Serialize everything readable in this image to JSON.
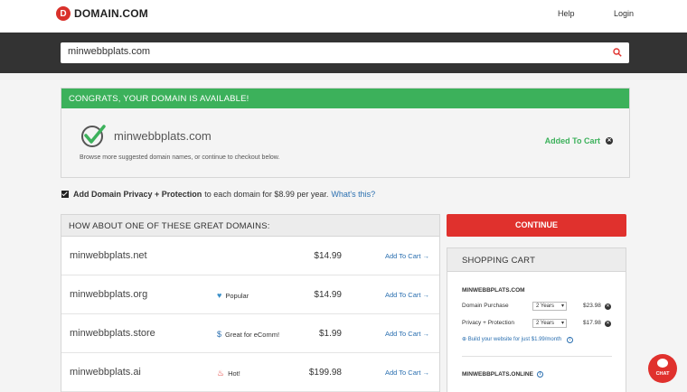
{
  "header": {
    "logo_text": "DOMAIN.COM",
    "logo_letter": "D",
    "help": "Help",
    "login": "Login"
  },
  "search": {
    "value": "minwebbplats.com"
  },
  "available": {
    "heading": "CONGRATS, YOUR DOMAIN IS AVAILABLE!",
    "domain": "minwebbplats.com",
    "subtext": "Browse more suggested domain names, or continue to checkout below.",
    "status": "Added To Cart"
  },
  "privacy": {
    "bold": "Add Domain Privacy + Protection",
    "text": "to each domain for $8.99 per year.",
    "link": "What's this?"
  },
  "suggestions": {
    "heading": "HOW ABOUT ONE OF THESE GREAT DOMAINS:",
    "add_label": "Add To Cart →",
    "rows": [
      {
        "name": "minwebbplats.net",
        "badge": "",
        "badge_icon": "",
        "price": "$14.99"
      },
      {
        "name": "minwebbplats.org",
        "badge": "Popular",
        "badge_icon": "heart-icon",
        "price": "$14.99"
      },
      {
        "name": "minwebbplats.store",
        "badge": "Great for eComm!",
        "badge_icon": "dollar-icon",
        "price": "$1.99"
      },
      {
        "name": "minwebbplats.ai",
        "badge": "Hot!",
        "badge_icon": "fire-icon",
        "price": "$199.98"
      }
    ]
  },
  "continue_label": "CONTINUE",
  "cart": {
    "heading": "SHOPPING CART",
    "domain": "MINWEBBPLATS.COM",
    "lines": [
      {
        "label": "Domain Purchase",
        "term": "2 Years",
        "price": "$23.98"
      },
      {
        "label": "Privacy + Protection",
        "term": "2 Years",
        "price": "$17.98"
      }
    ],
    "build": "Build your website for just $1.99/month",
    "domain2": "MINWEBBPLATS.ONLINE"
  },
  "chat_label": "CHAT",
  "colors": {
    "brand_red": "#e0312d",
    "success_green": "#3cb15b",
    "link_blue": "#2a6fb0",
    "dark_band": "#333333"
  }
}
